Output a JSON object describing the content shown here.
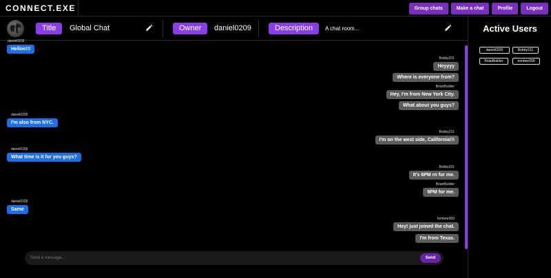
{
  "app": {
    "title": "CONNECT.EXE"
  },
  "nav": [
    {
      "label": "Group chats"
    },
    {
      "label": "Make a chat"
    },
    {
      "label": "Profile"
    },
    {
      "label": "Logout"
    }
  ],
  "chat_info": {
    "title_label": "Title",
    "title_value": "Global Chat",
    "owner_label": "Owner",
    "owner_value": "daniel0209",
    "description_label": "Description",
    "description_value": "A chat room..."
  },
  "messages": [
    {
      "sender": "daniel0209",
      "text": "Helloo!!!",
      "mine": true
    },
    {
      "sender": "Bobby231",
      "text": "Heyyyy",
      "mine": false
    },
    {
      "sender": "",
      "text": "Where is everyone from?",
      "mine": false
    },
    {
      "sender": "BrianBuilder",
      "text": "Hey, I'm from New York City.",
      "mine": false
    },
    {
      "sender": "",
      "text": "What about you guys?",
      "mine": false
    },
    {
      "sender": "daniel0209",
      "text": "I'm also from NYC.",
      "mine": true
    },
    {
      "sender": "Bobby231",
      "text": "I'm on the west side, California!!!",
      "mine": false
    },
    {
      "sender": "daniel0209",
      "text": "What time is it for you guys?",
      "mine": true
    },
    {
      "sender": "Bobby231",
      "text": "It's 6PM rn for me.",
      "mine": false
    },
    {
      "sender": "BrianBuilder",
      "text": "9PM for me.",
      "mine": false
    },
    {
      "sender": "daniel0209",
      "text": "Same",
      "mine": true
    },
    {
      "sender": "tombee999",
      "text": "Hey! just joined the chat.",
      "mine": false
    },
    {
      "sender": "",
      "text": "I'm from Texas.",
      "mine": false
    }
  ],
  "composer": {
    "placeholder": "Send a message...",
    "send_label": "Send"
  },
  "sidebar": {
    "title": "Active Users",
    "users": [
      "daniel0209",
      "Bobby231",
      "BrianBuilder",
      "tombee999"
    ]
  },
  "colors": {
    "accent": "#8a3ee8",
    "my_bubble": "#1e6fe3",
    "other_bubble": "#5c5c5c",
    "nav_button": "#7b2fbf"
  }
}
